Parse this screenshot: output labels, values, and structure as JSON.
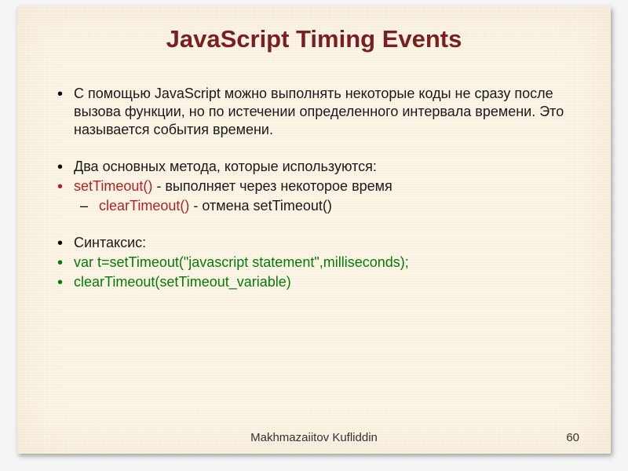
{
  "title": "JavaScript Timing Events",
  "items": {
    "p1": "С помощью JavaScript можно выполнять некоторые коды не сразу после вызова функции, но по истечении определенного интервала времени. Это называется события времени.",
    "p2": "Два основных метода, которые используются:",
    "p3a": "setTimeout()",
    "p3b": " - выполняет через некоторое время",
    "p4a": "clearTimeout()",
    "p4b": " - отмена setTimeout()",
    "p5": "Синтаксис:",
    "p6": "var t=setTimeout(\"javascript statement\",milliseconds);",
    "p7": "clearTimeout(setTimeout_variable)"
  },
  "footer": {
    "author": "Makhmazaiitov Kufliddin",
    "page": "60"
  }
}
